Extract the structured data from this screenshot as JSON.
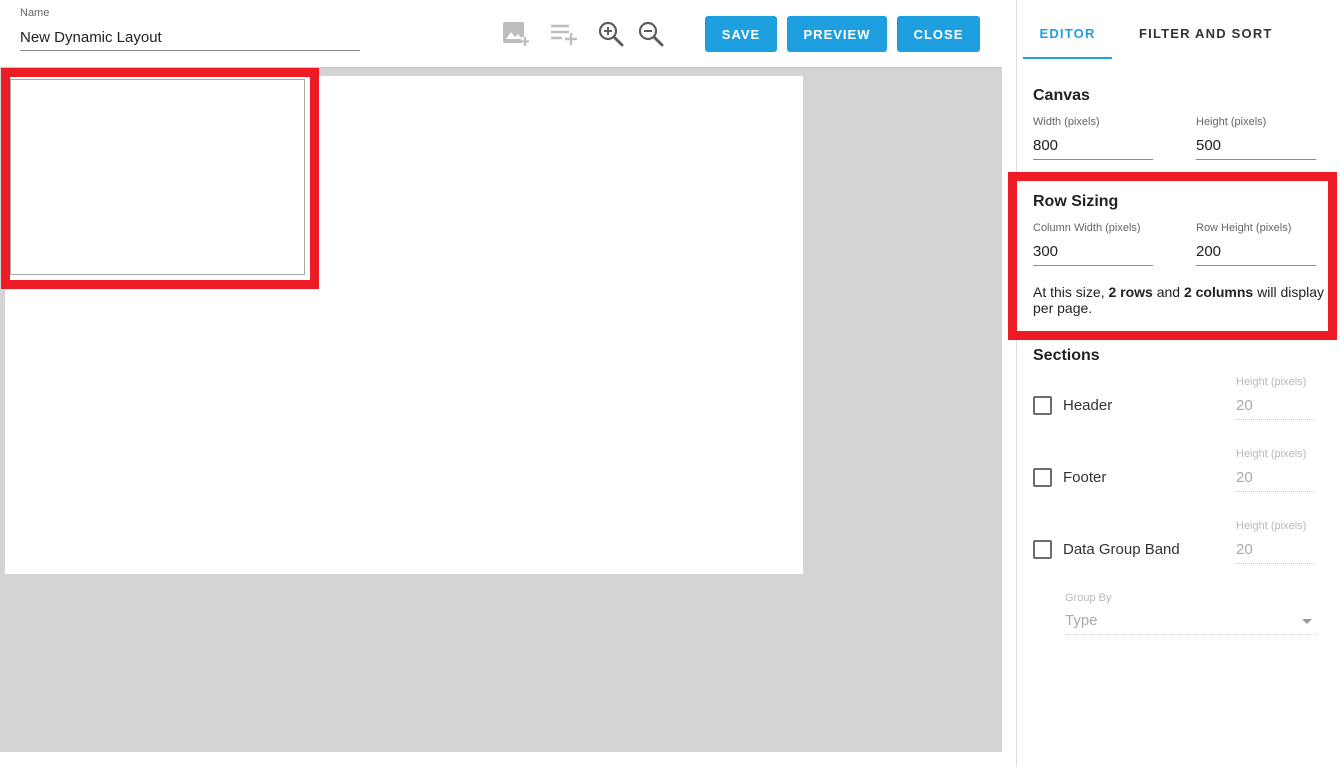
{
  "header": {
    "name_label": "Name",
    "name_value": "New Dynamic Layout",
    "buttons": {
      "save": "SAVE",
      "preview": "PREVIEW",
      "close": "CLOSE"
    },
    "icons": [
      "add-image-icon",
      "add-row-icon",
      "zoom-in-icon",
      "zoom-out-icon"
    ]
  },
  "tabs": {
    "editor": "EDITOR",
    "filter_sort": "FILTER AND SORT",
    "active": "editor"
  },
  "canvas": {
    "title": "Canvas",
    "width_label": "Width (pixels)",
    "width_value": "800",
    "height_label": "Height (pixels)",
    "height_value": "500"
  },
  "row_sizing": {
    "title": "Row Sizing",
    "col_width_label": "Column Width (pixels)",
    "col_width_value": "300",
    "row_height_label": "Row Height (pixels)",
    "row_height_value": "200",
    "info_prefix": "At this size, ",
    "info_rows": "2 rows",
    "info_mid": " and ",
    "info_cols": "2 columns",
    "info_suffix": " will display per page."
  },
  "sections": {
    "title": "Sections",
    "items": [
      {
        "label": "Header",
        "checked": false,
        "height_label": "Height (pixels)",
        "height_value": "20"
      },
      {
        "label": "Footer",
        "checked": false,
        "height_label": "Height (pixels)",
        "height_value": "20"
      },
      {
        "label": "Data Group Band",
        "checked": false,
        "height_label": "Height (pixels)",
        "height_value": "20"
      }
    ],
    "group_by_label": "Group By",
    "group_by_value": "Type"
  },
  "colors": {
    "accent": "#1e9fe0",
    "highlight": "#ed1c24",
    "workspace": "#d4d4d4"
  }
}
